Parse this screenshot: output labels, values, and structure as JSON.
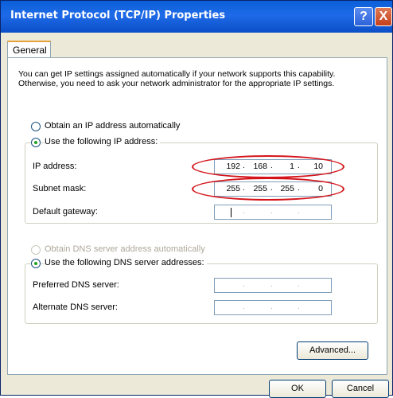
{
  "window": {
    "title": "Internet Protocol (TCP/IP) Properties",
    "help_glyph": "?",
    "close_glyph": "X"
  },
  "tabs": [
    {
      "label": "General"
    }
  ],
  "description": "You can get IP settings assigned automatically if your network supports this capability. Otherwise, you need to ask your network administrator for the appropriate IP settings.",
  "ip_section": {
    "auto_option": "Obtain an IP address automatically",
    "manual_option": "Use the following IP address:",
    "selected": "manual",
    "ip_address": {
      "label": "IP address:",
      "octets": [
        "192",
        "168",
        "1",
        "10"
      ]
    },
    "subnet_mask": {
      "label": "Subnet mask:",
      "octets": [
        "255",
        "255",
        "255",
        "0"
      ]
    },
    "default_gateway": {
      "label": "Default gateway:",
      "octets": [
        "",
        "",
        "",
        ""
      ]
    }
  },
  "dns_section": {
    "auto_option": "Obtain DNS server address automatically",
    "manual_option": "Use the following DNS server addresses:",
    "selected": "manual",
    "preferred": {
      "label": "Preferred DNS server:",
      "octets": [
        "",
        "",
        "",
        ""
      ]
    },
    "alternate": {
      "label": "Alternate DNS server:",
      "octets": [
        "",
        "",
        "",
        ""
      ]
    }
  },
  "buttons": {
    "advanced": "Advanced...",
    "ok": "OK",
    "cancel": "Cancel"
  },
  "colors": {
    "titlebar": "#0a5fd8",
    "annotation_ring": "#d4141a",
    "radio_dot": "#21a121"
  }
}
